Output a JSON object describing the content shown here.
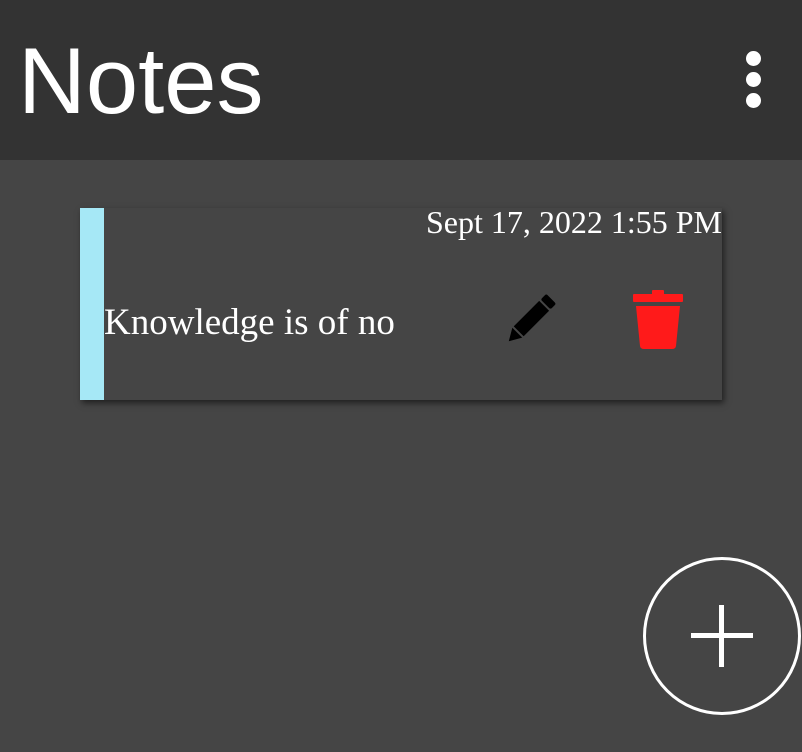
{
  "app_bar": {
    "title": "Notes",
    "menu_icon": "more-vertical-icon"
  },
  "notes": [
    {
      "date": "Sept 17, 2022 1:55 PM",
      "text": "Knowledge is of no",
      "accent_color": "#a6e8f6",
      "edit_icon": "pencil-icon",
      "delete_icon": "trash-icon",
      "delete_color": "#ff1a1a"
    }
  ],
  "fab": {
    "icon": "plus-icon"
  },
  "colors": {
    "background": "#454545",
    "app_bar": "#333333",
    "text": "#ffffff"
  }
}
